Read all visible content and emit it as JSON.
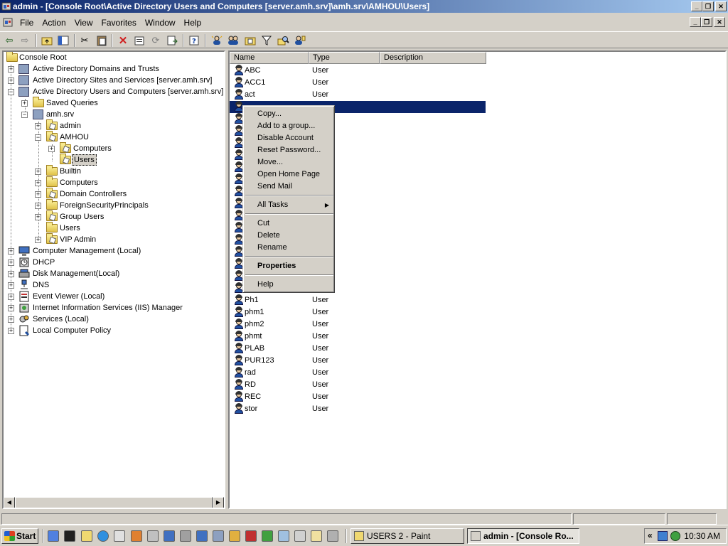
{
  "window": {
    "title": "admin - [Console Root\\Active Directory Users and Computers [server.amh.srv]\\amh.srv\\AMHOU\\Users]"
  },
  "menu": {
    "items": [
      {
        "label": "File"
      },
      {
        "label": "Action"
      },
      {
        "label": "View"
      },
      {
        "label": "Favorites"
      },
      {
        "label": "Window"
      },
      {
        "label": "Help"
      }
    ]
  },
  "tree": {
    "items": [
      {
        "label": "Console Root",
        "level": 0
      },
      {
        "label": "Active Directory Domains and Trusts",
        "level": 1
      },
      {
        "label": "Active Directory Sites and Services [server.amh.srv]",
        "level": 1
      },
      {
        "label": "Active Directory Users and Computers [server.amh.srv]",
        "level": 1
      },
      {
        "label": "Saved Queries",
        "level": 2
      },
      {
        "label": "amh.srv",
        "level": 2
      },
      {
        "label": "admin",
        "level": 3
      },
      {
        "label": "AMHOU",
        "level": 3
      },
      {
        "label": "Computers",
        "level": 4
      },
      {
        "label": "Users",
        "level": 4
      },
      {
        "label": "Builtin",
        "level": 3
      },
      {
        "label": "Computers",
        "level": 3
      },
      {
        "label": "Domain Controllers",
        "level": 3
      },
      {
        "label": "ForeignSecurityPrincipals",
        "level": 3
      },
      {
        "label": "Group Users",
        "level": 3
      },
      {
        "label": "Users",
        "level": 3
      },
      {
        "label": "VIP Admin",
        "level": 3
      },
      {
        "label": "Computer Management (Local)",
        "level": 1
      },
      {
        "label": "DHCP",
        "level": 1
      },
      {
        "label": "Disk Management(Local)",
        "level": 1
      },
      {
        "label": "DNS",
        "level": 1
      },
      {
        "label": "Event Viewer (Local)",
        "level": 1
      },
      {
        "label": "Internet Information Services (IIS) Manager",
        "level": 1
      },
      {
        "label": "Services (Local)",
        "level": 1
      },
      {
        "label": "Local Computer Policy",
        "level": 1
      }
    ]
  },
  "list": {
    "columns": [
      {
        "label": "Name"
      },
      {
        "label": "Type"
      },
      {
        "label": "Description"
      }
    ],
    "rows": [
      {
        "name": "ABC",
        "type": "User"
      },
      {
        "name": "ACC1",
        "type": "User"
      },
      {
        "name": "act",
        "type": "User"
      },
      {
        "name": "",
        "type": ""
      },
      {
        "name": "Ph1",
        "type": "User"
      },
      {
        "name": "phm1",
        "type": "User"
      },
      {
        "name": "phm2",
        "type": "User"
      },
      {
        "name": "phmt",
        "type": "User"
      },
      {
        "name": "PLAB",
        "type": "User"
      },
      {
        "name": "PUR123",
        "type": "User"
      },
      {
        "name": "rad",
        "type": "User"
      },
      {
        "name": "RD",
        "type": "User"
      },
      {
        "name": "REC",
        "type": "User"
      },
      {
        "name": "stor",
        "type": "User"
      }
    ]
  },
  "context_menu": {
    "items": [
      {
        "label": "Copy..."
      },
      {
        "label": "Add to a group..."
      },
      {
        "label": "Disable Account"
      },
      {
        "label": "Reset Password..."
      },
      {
        "label": "Move..."
      },
      {
        "label": "Open Home Page"
      },
      {
        "label": "Send Mail"
      },
      {
        "label": "All Tasks"
      },
      {
        "label": "Cut"
      },
      {
        "label": "Delete"
      },
      {
        "label": "Rename"
      },
      {
        "label": "Properties"
      },
      {
        "label": "Help"
      }
    ]
  },
  "taskbar": {
    "start_label": "Start",
    "buttons": [
      {
        "label": "USERS 2 - Paint"
      },
      {
        "label": "admin - [Console Ro..."
      }
    ],
    "tray_chevron": "«",
    "clock": "10:30 AM"
  }
}
